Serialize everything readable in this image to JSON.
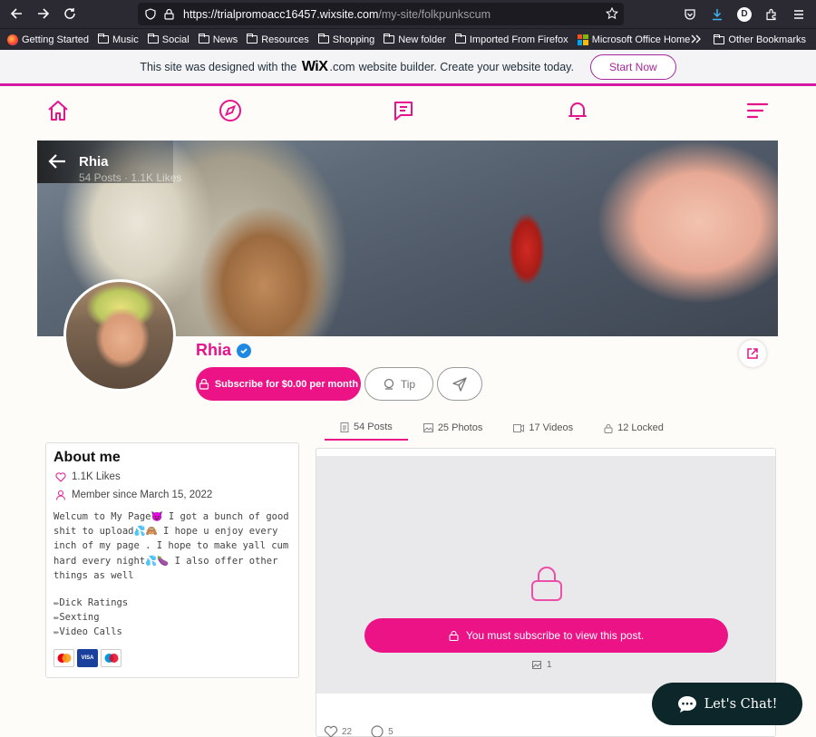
{
  "browser": {
    "url_host": "https://trialpromoacc16457.wixsite.com",
    "url_path": "/my-site/folkpunkscum",
    "profile_initial": "D"
  },
  "bookmarks": {
    "items": [
      {
        "label": "Getting Started",
        "icon": "firefox-icon"
      },
      {
        "label": "Music",
        "icon": "folder-icon"
      },
      {
        "label": "Social",
        "icon": "folder-icon"
      },
      {
        "label": "News",
        "icon": "folder-icon"
      },
      {
        "label": "Resources",
        "icon": "folder-icon"
      },
      {
        "label": "Shopping",
        "icon": "folder-icon"
      },
      {
        "label": "New folder",
        "icon": "folder-icon"
      },
      {
        "label": "Imported From Firefox",
        "icon": "folder-icon"
      },
      {
        "label": "Microsoft Office Home",
        "icon": "microsoft-icon"
      }
    ],
    "other": "Other Bookmarks"
  },
  "wix_banner": {
    "text_before": "This site was designed with the",
    "logo": "WiX",
    "logo_suffix": ".com",
    "text_after": "website builder. Create your website today.",
    "cta": "Start Now",
    "accent": "#d41aa3"
  },
  "profile": {
    "name": "Rhia",
    "cover_title": "Rhia",
    "cover_sub": "54 Posts · 1.1K Likes",
    "subscribe_label": "Subscribe for $0.00 per month",
    "tip_label": "Tip",
    "accent": "#ec1387"
  },
  "tabs": [
    {
      "label": "54 Posts",
      "icon": "document-icon"
    },
    {
      "label": "25 Photos",
      "icon": "image-icon"
    },
    {
      "label": "17 Videos",
      "icon": "video-icon"
    },
    {
      "label": "12 Locked",
      "icon": "lock-icon"
    }
  ],
  "about": {
    "title": "About me",
    "likes": "1.1K Likes",
    "member_since": "Member since March 15, 2022",
    "bio": "Welcum to My Page😈 I got a bunch of good shit to upload💦🙈 I hope u enjoy every inch of my page . I hope to make yall cum hard every night💦🍆 I also offer other things as well",
    "services": [
      "✏Dick Ratings",
      "✏Sexting",
      "✏Video Calls"
    ],
    "cards": [
      {
        "name": "MasterCard",
        "color": "#e9472f"
      },
      {
        "name": "VISA",
        "color": "#1a3f9c"
      },
      {
        "name": "Maestro",
        "color": "#2b5ab7"
      }
    ]
  },
  "post": {
    "locked_message": "You must subscribe to view this post.",
    "media_count": "1",
    "likes": "22",
    "comments": "5"
  },
  "chat": {
    "label": "Let's Chat!"
  }
}
